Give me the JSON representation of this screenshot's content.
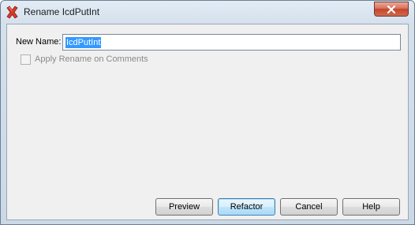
{
  "window": {
    "title": "Rename  IcdPutInt",
    "app_icon": "red-x-icon",
    "close_icon": "close-icon",
    "close_color": "#c4462b"
  },
  "form": {
    "name_label": "New Name:",
    "name_value": "IcdPutInt",
    "apply_on_comments_label": "Apply Rename on Comments",
    "apply_on_comments_checked": false,
    "apply_on_comments_enabled": false
  },
  "buttons": {
    "preview": "Preview",
    "refactor": "Refactor",
    "cancel": "Cancel",
    "help": "Help"
  },
  "colors": {
    "selection": "#3399ff",
    "default_button_border": "#3c7fb1"
  }
}
